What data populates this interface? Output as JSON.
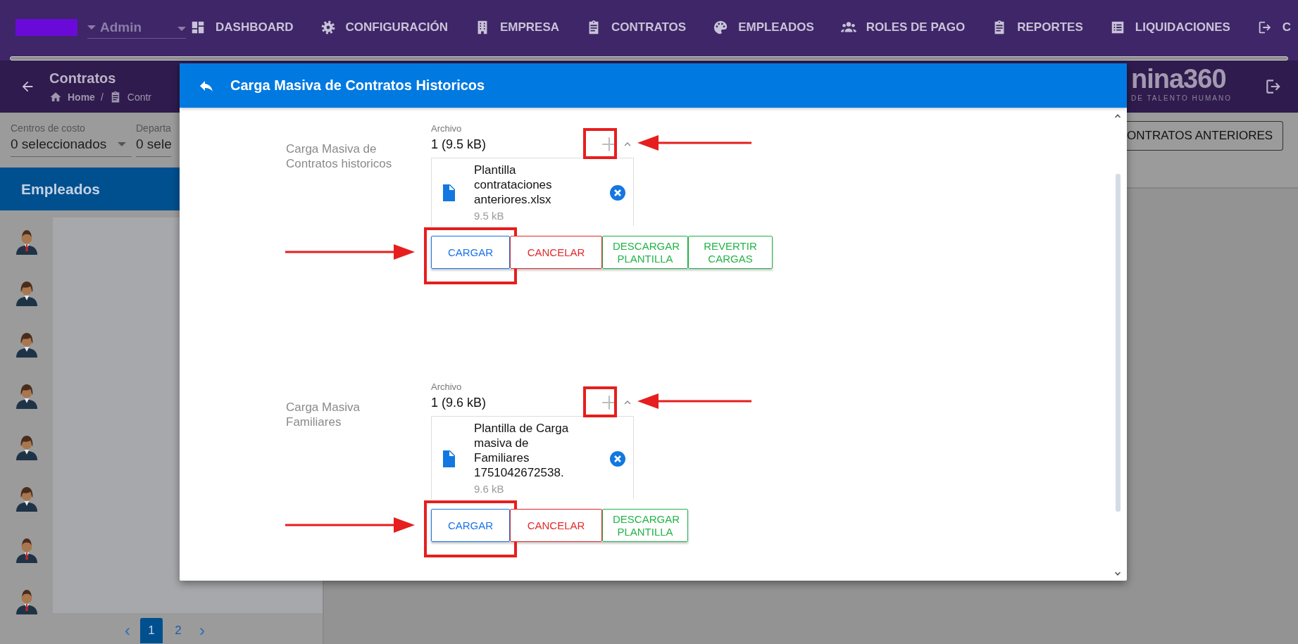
{
  "top_nav": {
    "user": "Admin",
    "items": [
      {
        "label": "DASHBOARD"
      },
      {
        "label": "CONFIGURACIÓN"
      },
      {
        "label": "EMPRESA"
      },
      {
        "label": "CONTRATOS"
      },
      {
        "label": "EMPLEADOS"
      },
      {
        "label": "ROLES DE PAGO"
      },
      {
        "label": "REPORTES"
      },
      {
        "label": "LIQUIDACIONES"
      },
      {
        "label": "C"
      }
    ]
  },
  "header": {
    "title": "Contratos",
    "breadcrumb": [
      "Home",
      "Contr"
    ],
    "breadcrumb_separator": "/",
    "logo": "nina360",
    "logo_tagline": "DE TALENTO HUMANO"
  },
  "filters": [
    {
      "label": "Centros de costo",
      "value": "0 seleccionados"
    },
    {
      "label": "Departa",
      "value": "0 sele"
    }
  ],
  "employees_panel": {
    "title": "Empleados",
    "employees": [
      {
        "kind": "male"
      },
      {
        "kind": "female"
      },
      {
        "kind": "female"
      },
      {
        "kind": "female"
      },
      {
        "kind": "female"
      },
      {
        "kind": "female"
      },
      {
        "kind": "male"
      },
      {
        "kind": "male"
      }
    ],
    "pagination": [
      {
        "label": "‹",
        "kind": "arrow",
        "selected": false
      },
      {
        "label": "1",
        "kind": "page",
        "selected": true
      },
      {
        "label": "2",
        "kind": "page",
        "selected": false
      },
      {
        "label": "›",
        "kind": "arrow",
        "selected": false
      }
    ]
  },
  "right_button": "ONTRATOS ANTERIORES",
  "modal": {
    "title": "Carga Masiva de Contratos Historicos",
    "sections": [
      {
        "label": "Carga Masiva de Contratos historicos",
        "field_label": "Archivo",
        "value": "1 (9.5 kB)",
        "add_highlighted": true,
        "files": [
          {
            "name": "Plantilla contrataciones anteriores.xlsx",
            "size": "9.5 kB"
          }
        ],
        "buttons": [
          {
            "label": "CARGAR",
            "kind": "primary",
            "highlighted": true
          },
          {
            "label": "CANCELAR",
            "kind": "danger",
            "highlighted": false
          },
          {
            "label": "DESCARGAR PLANTILLA",
            "kind": "success",
            "highlighted": false
          },
          {
            "label": "REVERTIR CARGAS",
            "kind": "success",
            "highlighted": false
          }
        ]
      },
      {
        "label": "Carga Masiva Familiares",
        "field_label": "Archivo",
        "value": "1 (9.6 kB)",
        "add_highlighted": true,
        "files": [
          {
            "name": "Plantilla de Carga masiva de Familiares 1751042672538.",
            "size": "9.6 kB"
          }
        ],
        "buttons": [
          {
            "label": "CARGAR",
            "kind": "primary",
            "highlighted": true
          },
          {
            "label": "CANCELAR",
            "kind": "danger",
            "highlighted": false
          },
          {
            "label": "DESCARGAR PLANTILLA",
            "kind": "success",
            "highlighted": false
          }
        ]
      }
    ]
  }
}
